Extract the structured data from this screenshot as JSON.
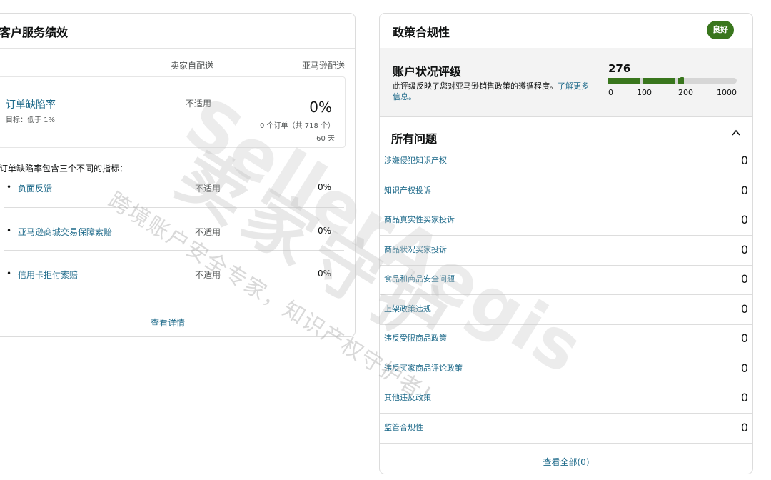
{
  "left": {
    "title": "客户服务绩效",
    "col_seller": "卖家自配送",
    "col_amazon": "亚马逊配送",
    "odr": {
      "title": "订单缺陷率",
      "target": "目标：低于 1%",
      "seller_value": "不适用",
      "amazon_value": "0%",
      "orders": "0 个订单（共 718 个）",
      "days": "60 天"
    },
    "description": "订单缺陷率包含三个不同的指标：",
    "metrics": [
      {
        "label": "负面反馈",
        "seller": "不适用",
        "amazon": "0%"
      },
      {
        "label": "亚马逊商城交易保障索赔",
        "seller": "不适用",
        "amazon": "0%"
      },
      {
        "label": "信用卡拒付索赔",
        "seller": "不适用",
        "amazon": "0%"
      }
    ],
    "bullet": "•",
    "view_details": "查看详情"
  },
  "right": {
    "title": "政策合规性",
    "badge": "良好",
    "ahr": {
      "title": "账户状况评级",
      "description": "此评级反映了您对亚马逊销售政策的遵循程度。",
      "learn_more": "了解更多信息。",
      "score": "276",
      "score_value": 276,
      "ticks": [
        "0",
        "100",
        "200",
        "1000"
      ]
    },
    "issues_title": "所有问题",
    "issues": [
      {
        "label": "涉嫌侵犯知识产权",
        "count": "0"
      },
      {
        "label": "知识产权投诉",
        "count": "0"
      },
      {
        "label": "商品真实性买家投诉",
        "count": "0"
      },
      {
        "label": "商品状况买家投诉",
        "count": "0"
      },
      {
        "label": "食品和商品安全问题",
        "count": "0"
      },
      {
        "label": "上架政策违规",
        "count": "0"
      },
      {
        "label": "违反受限商品政策",
        "count": "0"
      },
      {
        "label": "违反买家商品评论政策",
        "count": "0"
      },
      {
        "label": "其他违反政策",
        "count": "0"
      },
      {
        "label": "监管合规性",
        "count": "0"
      }
    ],
    "view_all": "查看全部(0)"
  },
  "watermark": {
    "brand": "SellerAegis",
    "cn": "卖家守护",
    "sub": "跨境账户安全专家，知识产权守护者！"
  },
  "colors": {
    "link": "#1e6a8a",
    "good": "#39761d",
    "bar_bg": "#d6d6d6"
  },
  "icons": {
    "collapse": "chevron-up-icon",
    "bullet": "bullet-icon"
  }
}
